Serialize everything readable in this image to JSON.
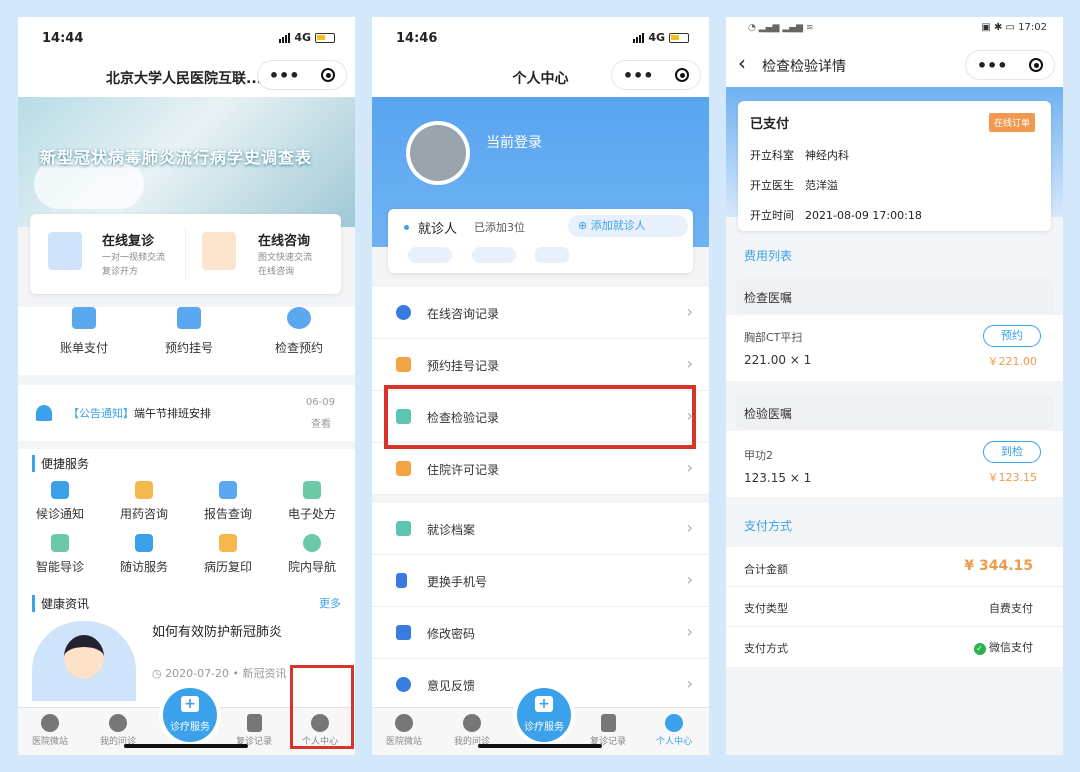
{
  "p1": {
    "time": "14:44",
    "net": "4G",
    "title": "北京大学人民医院互联...",
    "banner_text": "新型冠状病毒肺炎流行病学史调查表",
    "feat": [
      {
        "title": "在线复诊",
        "sub1": "一对一视频交流",
        "sub2": "复诊开方"
      },
      {
        "title": "在线咨询",
        "sub1": "图文快速交流",
        "sub2": "在线咨询"
      }
    ],
    "quick": [
      "账单支付",
      "预约挂号",
      "检查预约"
    ],
    "notice": {
      "tag": "【公告通知】",
      "text": "端午节排班安排",
      "date": "06-09",
      "action": "查看"
    },
    "conv_title": "便捷服务",
    "conv": [
      "候诊通知",
      "用药咨询",
      "报告查询",
      "电子处方",
      "智能导诊",
      "随访服务",
      "病历复印",
      "院内导航"
    ],
    "health_title": "健康资讯",
    "more": "更多",
    "article": "如何有效防护新冠肺炎",
    "article_date": "2020-07-20",
    "article_src": "新冠资讯",
    "tabs": [
      "医院微站",
      "我的问诊",
      "诊疗服务",
      "复诊记录",
      "个人中心"
    ]
  },
  "p2": {
    "time": "14:46",
    "net": "4G",
    "title": "个人中心",
    "login": "当前登录",
    "patient_label": "就诊人",
    "patient_count": "已添加3位",
    "add_patient": "添加就诊人",
    "menu": [
      "在线咨询记录",
      "预约挂号记录",
      "检查检验记录",
      "住院许可记录",
      "就诊档案",
      "更换手机号",
      "修改密码",
      "意见反馈"
    ],
    "tabs": [
      "医院微站",
      "我的问诊",
      "诊疗服务",
      "复诊记录",
      "个人中心"
    ]
  },
  "p3": {
    "time": "17:02",
    "title": "检查检验详情",
    "status": "已支付",
    "badge": "在线订单",
    "info": [
      {
        "k": "开立科室",
        "v": "神经内科"
      },
      {
        "k": "开立医生",
        "v": "范洋溢"
      },
      {
        "k": "开立时间",
        "v": "2021-08-09 17:00:18"
      }
    ],
    "fee_title": "费用列表",
    "groups": [
      {
        "head": "检查医嘱",
        "item": "胸部CT平扫",
        "qty": "221.00 × 1",
        "btn": "预约",
        "price": "￥221.00"
      },
      {
        "head": "检验医嘱",
        "item": "甲功2",
        "qty": "123.15 × 1",
        "btn": "到检",
        "price": "￥123.15"
      }
    ],
    "pay_title": "支付方式",
    "total_label": "合计金额",
    "total": "¥ 344.15",
    "type_label": "支付类型",
    "type": "自费支付",
    "method_label": "支付方式",
    "method": "微信支付"
  },
  "colors": {
    "accent": "#3aa1ea",
    "highlight": "#d9342b",
    "orange": "#f19a4f"
  }
}
